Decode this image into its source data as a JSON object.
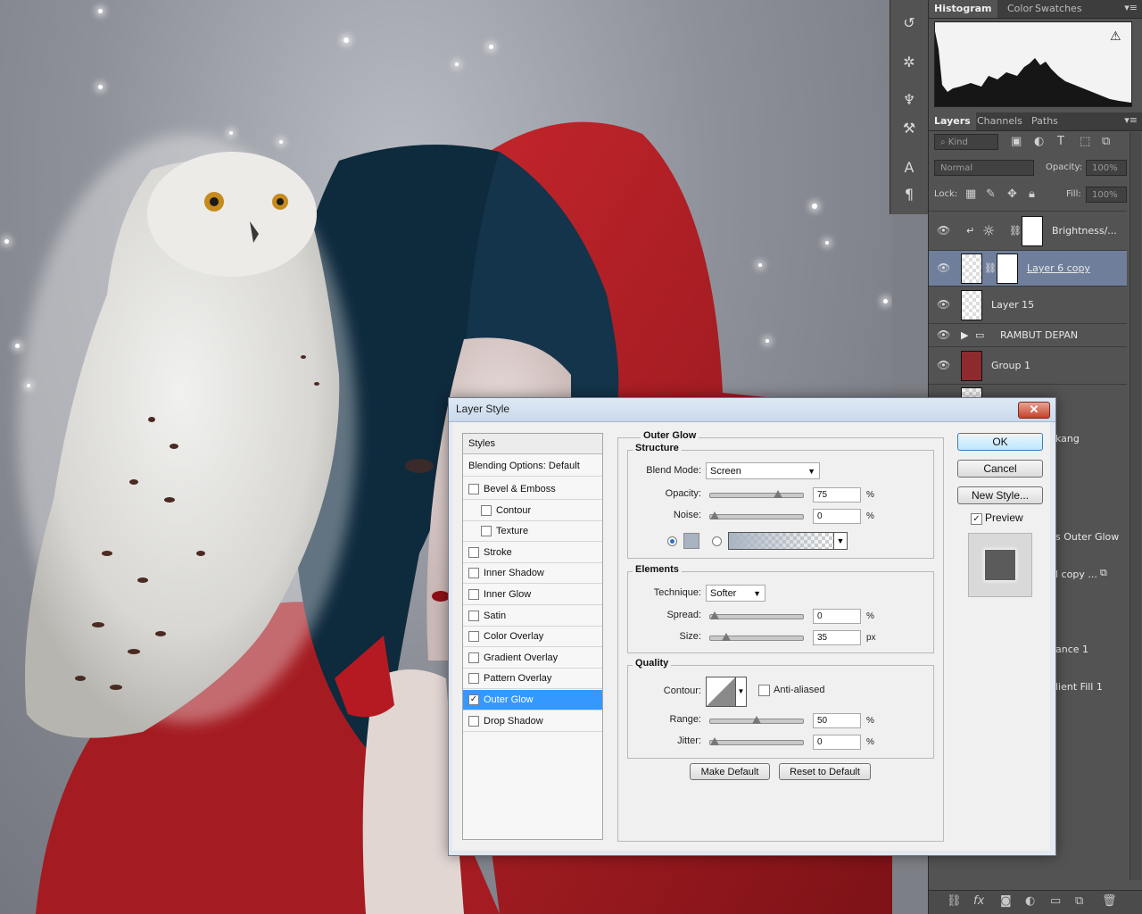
{
  "canvas": {
    "background_color": "#8e9199",
    "accent_red": "#a31e24",
    "hair_color": "#0e2a3d"
  },
  "right_panel": {
    "top_tabs": [
      "Histogram",
      "Color",
      "Swatches"
    ],
    "layers_tabs": [
      "Layers",
      "Channels",
      "Paths"
    ],
    "filter_kind": "Kind",
    "blend_mode": "Normal",
    "opacity_label": "Opacity:",
    "opacity_value": "100%",
    "lock_label": "Lock:",
    "fill_label": "Fill:",
    "fill_value": "100%",
    "layers": [
      {
        "name": "Brightness/...",
        "selected": false
      },
      {
        "name": "Layer 6 copy",
        "selected": true
      },
      {
        "name": "Layer 15",
        "selected": false
      },
      {
        "name": "RAMBUT DEPAN",
        "selected": false
      },
      {
        "name": "Group 1",
        "selected": false
      }
    ],
    "partial_layer_labels": [
      "kang",
      "s Outer Glow",
      "l copy ...",
      "ance 1",
      "lient Fill 1"
    ]
  },
  "dialog": {
    "title": "Layer Style",
    "close_glyph": "✕",
    "styles_header": "Styles",
    "style_items": [
      {
        "label": "Blending Options: Default",
        "has_checkbox": false,
        "checked": false,
        "indent": false
      },
      {
        "label": "Bevel & Emboss",
        "has_checkbox": true,
        "checked": false,
        "indent": false
      },
      {
        "label": "Contour",
        "has_checkbox": true,
        "checked": false,
        "indent": true
      },
      {
        "label": "Texture",
        "has_checkbox": true,
        "checked": false,
        "indent": true
      },
      {
        "label": "Stroke",
        "has_checkbox": true,
        "checked": false,
        "indent": false
      },
      {
        "label": "Inner Shadow",
        "has_checkbox": true,
        "checked": false,
        "indent": false
      },
      {
        "label": "Inner Glow",
        "has_checkbox": true,
        "checked": false,
        "indent": false
      },
      {
        "label": "Satin",
        "has_checkbox": true,
        "checked": false,
        "indent": false
      },
      {
        "label": "Color Overlay",
        "has_checkbox": true,
        "checked": false,
        "indent": false
      },
      {
        "label": "Gradient Overlay",
        "has_checkbox": true,
        "checked": false,
        "indent": false
      },
      {
        "label": "Pattern Overlay",
        "has_checkbox": true,
        "checked": false,
        "indent": false
      },
      {
        "label": "Outer Glow",
        "has_checkbox": true,
        "checked": true,
        "indent": false
      },
      {
        "label": "Drop Shadow",
        "has_checkbox": true,
        "checked": false,
        "indent": false
      }
    ],
    "section_title": "Outer Glow",
    "structure": {
      "title": "Structure",
      "blend_mode_label": "Blend Mode:",
      "blend_mode_value": "Screen",
      "opacity_label": "Opacity:",
      "opacity_value": "75",
      "opacity_level": 0.75,
      "noise_label": "Noise:",
      "noise_value": "0",
      "noise_level": 0,
      "unit_percent": "%",
      "glow_color": "#a9b4c2"
    },
    "elements": {
      "title": "Elements",
      "technique_label": "Technique:",
      "technique_value": "Softer",
      "spread_label": "Spread:",
      "spread_value": "0",
      "spread_level": 0,
      "size_label": "Size:",
      "size_value": "35",
      "size_level": 0.14,
      "unit_px": "px"
    },
    "quality": {
      "title": "Quality",
      "contour_label": "Contour:",
      "antialiased_label": "Anti-aliased",
      "range_label": "Range:",
      "range_value": "50",
      "range_level": 0.5,
      "jitter_label": "Jitter:",
      "jitter_value": "0",
      "jitter_level": 0
    },
    "make_default": "Make Default",
    "reset_default": "Reset to Default",
    "ok": "OK",
    "cancel": "Cancel",
    "new_style": "New Style...",
    "preview_label": "Preview",
    "preview_checked": true
  }
}
